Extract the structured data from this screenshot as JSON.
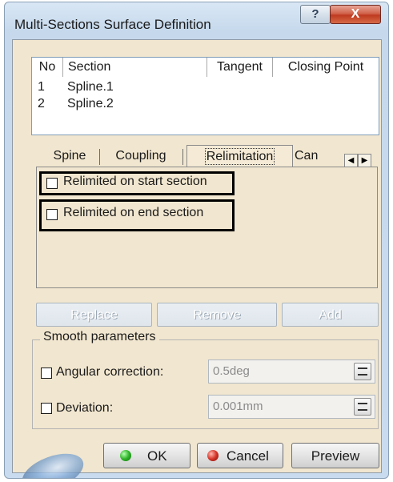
{
  "window": {
    "title": "Multi-Sections Surface Definition",
    "help_label": "?",
    "close_label": "X"
  },
  "sections_table": {
    "columns": [
      "No",
      "Section",
      "Tangent",
      "Closing Point"
    ],
    "rows": [
      {
        "no": "1",
        "section": "Spline.1"
      },
      {
        "no": "2",
        "section": "Spline.2"
      }
    ]
  },
  "tabs": {
    "items": [
      "Spine",
      "Coupling",
      "Relimitation",
      "Can"
    ],
    "active": "Relimitation",
    "scroll_left": "◀",
    "scroll_right": "▶"
  },
  "relimitation": {
    "start_label": "Relimited on start section",
    "start_checked": false,
    "end_label": "Relimited on end section",
    "end_checked": false
  },
  "actions": {
    "replace": "Replace",
    "remove": "Remove",
    "add": "Add"
  },
  "smooth": {
    "title": "Smooth parameters",
    "angular_label": "Angular correction:",
    "angular_value": "0.5deg",
    "angular_checked": false,
    "deviation_label": "Deviation:",
    "deviation_value": "0.001mm",
    "deviation_checked": false
  },
  "buttons": {
    "ok": "OK",
    "cancel": "Cancel",
    "preview": "Preview"
  }
}
